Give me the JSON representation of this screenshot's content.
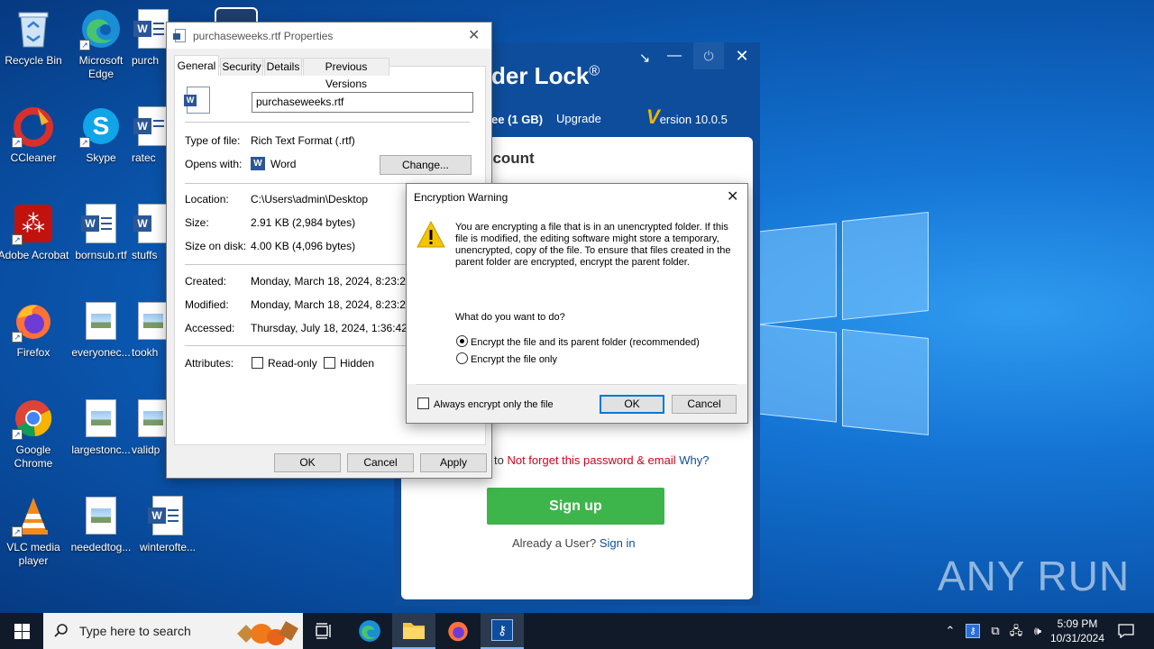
{
  "desktop_icons": [
    {
      "id": "recycle",
      "label": "Recycle Bin"
    },
    {
      "id": "edge",
      "label": "Microsoft Edge"
    },
    {
      "id": "purch",
      "label": "purch"
    },
    {
      "id": "ccleaner",
      "label": "CCleaner"
    },
    {
      "id": "skype",
      "label": "Skype"
    },
    {
      "id": "rated",
      "label": "ratec"
    },
    {
      "id": "acrobat",
      "label": "Adobe Acrobat"
    },
    {
      "id": "bornsub",
      "label": "bornsub.rtf"
    },
    {
      "id": "stuff",
      "label": "stuffs"
    },
    {
      "id": "firefox",
      "label": "Firefox"
    },
    {
      "id": "everyone",
      "label": "everyonec..."
    },
    {
      "id": "tookh",
      "label": "tookh"
    },
    {
      "id": "chrome",
      "label": "Google Chrome"
    },
    {
      "id": "largest",
      "label": "largestonc..."
    },
    {
      "id": "valid",
      "label": "validp"
    },
    {
      "id": "vlc",
      "label": "VLC media player"
    },
    {
      "id": "needed",
      "label": "neededtog..."
    },
    {
      "id": "winter",
      "label": "winterofte..."
    }
  ],
  "folder_lock": {
    "title_partial": "der Lock",
    "reg": "®",
    "plan_partial": "ree (1 GB)",
    "upgrade": "Upgrade",
    "version_v": "V",
    "version": "ersion 10.0.5",
    "account_partial": "ccount",
    "notice_prefix": "to",
    "notice_warn": "Not forget this password & email",
    "notice_why": "Why?",
    "signup": "Sign up",
    "already": "Already a User?",
    "signin": "Sign in"
  },
  "properties": {
    "title": "purchaseweeks.rtf Properties",
    "tabs": [
      "General",
      "Security",
      "Details",
      "Previous Versions"
    ],
    "filename": "purchaseweeks.rtf",
    "type_label": "Type of file:",
    "type_value": "Rich Text Format (.rtf)",
    "opens_label": "Opens with:",
    "opens_value": "Word",
    "change": "Change...",
    "location_label": "Location:",
    "location_value": "C:\\Users\\admin\\Desktop",
    "size_label": "Size:",
    "size_value": "2.91 KB (2,984 bytes)",
    "sizedisk_label": "Size on disk:",
    "sizedisk_value": "4.00 KB (4,096 bytes)",
    "created_label": "Created:",
    "created_value": "Monday, March 18, 2024, 8:23:21 A",
    "modified_label": "Modified:",
    "modified_value": "Monday, March 18, 2024, 8:23:21 A",
    "accessed_label": "Accessed:",
    "accessed_value": "Thursday, July 18, 2024, 1:36:42 PM",
    "attributes_label": "Attributes:",
    "readonly": "Read-only",
    "hidden": "Hidden",
    "ok": "OK",
    "cancel": "Cancel",
    "apply": "Apply"
  },
  "warning": {
    "title": "Encryption Warning",
    "message": "You are encrypting a file that is in an unencrypted folder. If this file is modified, the editing software might store a temporary, unencrypted, copy of the file. To ensure that files created in the parent folder are encrypted, encrypt the parent folder.",
    "question": "What do you want to do?",
    "option1": "Encrypt the file and its parent folder (recommended)",
    "option2": "Encrypt the file only",
    "selected_option": 1,
    "always": "Always encrypt only the file",
    "ok": "OK",
    "cancel": "Cancel"
  },
  "taskbar": {
    "search_placeholder": "Type here to search",
    "time": "5:09 PM",
    "date": "10/31/2024"
  },
  "watermark": "ANY RUN",
  "colors": {
    "folder_lock_blue": "#0e4d9c",
    "signup_green": "#3db54a",
    "warn_red": "#d0021b",
    "link_blue": "#0e4d9c",
    "taskbar": "#101a29"
  }
}
